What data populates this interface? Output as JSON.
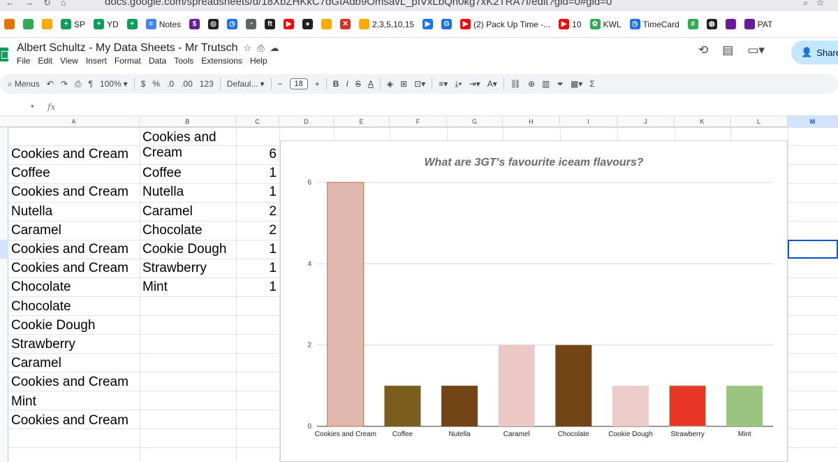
{
  "browser": {
    "url": "docs.google.com/spreadsheets/d/18XbZHKkC7dGIAdb9OmsavL_pIVxLbQn0kg7xK2TRA7I/edit?gid=0#gid=0"
  },
  "bookmarks": [
    {
      "label": "",
      "icon": "bookmark-orange-icon",
      "color": "#e37400"
    },
    {
      "label": "",
      "icon": "drive-icon",
      "color": "#34a853"
    },
    {
      "label": "",
      "icon": "folder-yellow-icon",
      "color": "#f9ab00"
    },
    {
      "label": "SP",
      "icon": "sheets-icon",
      "color": "#0f9d58"
    },
    {
      "label": "YD",
      "icon": "sheets-icon",
      "color": "#0f9d58"
    },
    {
      "label": "",
      "icon": "sheets-icon",
      "color": "#0f9d58"
    },
    {
      "label": "Notes",
      "icon": "docs-icon",
      "color": "#4285f4"
    },
    {
      "label": "",
      "icon": "dollar-icon",
      "color": "#6a1b9a"
    },
    {
      "label": "",
      "icon": "circle-icon",
      "color": "#202124"
    },
    {
      "label": "",
      "icon": "timer-icon",
      "color": "#1a73e8"
    },
    {
      "label": "",
      "icon": "arc-icon",
      "color": "#5f6368"
    },
    {
      "label": "",
      "icon": "ft-icon",
      "color": "#202124"
    },
    {
      "label": "",
      "icon": "youtube-icon",
      "color": "#ff0000"
    },
    {
      "label": "",
      "icon": "bomb-icon",
      "color": "#202124"
    },
    {
      "label": "",
      "icon": "folder-yellow-icon",
      "color": "#f9ab00"
    },
    {
      "label": "",
      "icon": "close-red-icon",
      "color": "#d93025"
    },
    {
      "label": "2,3,5,10,15",
      "icon": "folder-yellow-icon",
      "color": "#f9ab00"
    },
    {
      "label": "",
      "icon": "play-icon",
      "color": "#1a73e8"
    },
    {
      "label": "",
      "icon": "g-icon",
      "color": "#1a73e8"
    },
    {
      "label": "(2) Pack Up Time -...",
      "icon": "youtube-icon",
      "color": "#ff0000"
    },
    {
      "label": "10",
      "icon": "youtube-icon",
      "color": "#ff0000"
    },
    {
      "label": "KWL",
      "icon": "kwl-icon",
      "color": "#34a853"
    },
    {
      "label": "TimeCard",
      "icon": "timer-icon",
      "color": "#1a73e8"
    },
    {
      "label": "",
      "icon": "grid-icon",
      "color": "#34a853"
    },
    {
      "label": "",
      "icon": "abc-icon",
      "color": "#202124"
    },
    {
      "label": "",
      "icon": "bookmark-purple-icon",
      "color": "#6a1b9a"
    },
    {
      "label": "PAT",
      "icon": "bookmark-purple-icon",
      "color": "#6a1b9a"
    }
  ],
  "doc": {
    "title": "Albert Schultz - My Data Sheets - Mr Trutsch",
    "menu": [
      "File",
      "Edit",
      "View",
      "Insert",
      "Format",
      "Data",
      "Tools",
      "Extensions",
      "Help"
    ],
    "share_label": "Share"
  },
  "toolbar": {
    "menus_label": "Menus",
    "zoom": "100%",
    "currency": "$",
    "percent": "%",
    "dec_less": ".0",
    "dec_more": ".00",
    "number_format": "123",
    "font": "Defaul...",
    "font_size": "18",
    "bold": "B",
    "italic": "I",
    "strike": "S",
    "text_color": "A",
    "sum": "Σ"
  },
  "formula_bar": {
    "fx": "fx"
  },
  "columns": [
    "A",
    "B",
    "C",
    "D",
    "E",
    "F",
    "G",
    "H",
    "I",
    "J",
    "K",
    "L",
    "M"
  ],
  "selected_column": "M",
  "colA": [
    "Cookies and Cream",
    "Coffee",
    "Cookies and Cream",
    "Nutella",
    "Caramel",
    "Cookies and Cream",
    "Cookies and Cream",
    "Chocolate",
    "Chocolate",
    "Cookie Dough",
    "Strawberry",
    "Caramel",
    "Cookies and Cream",
    "Mint",
    "Cookies and Cream"
  ],
  "colB": [
    "Cookies and Cream",
    "Coffee",
    "Nutella",
    "Caramel",
    "Chocolate",
    "Cookie Dough",
    "Strawberry",
    "Mint"
  ],
  "colC": [
    "6",
    "1",
    "1",
    "2",
    "2",
    "1",
    "1",
    "1"
  ],
  "chart_data": {
    "type": "bar",
    "title": "What are 3GT's favourite iceam flavours?",
    "categories": [
      "Cookies and Cream",
      "Coffee",
      "Nutella",
      "Caramel",
      "Chocolate",
      "Cookie Dough",
      "Strawberry",
      "Mint"
    ],
    "values": [
      6,
      1,
      1,
      2,
      2,
      1,
      1,
      1
    ],
    "colors": [
      "#e0b8ae",
      "#7b5e1e",
      "#734416",
      "#ecc9c5",
      "#734416",
      "#ecccc9",
      "#e83526",
      "#9bc480"
    ],
    "ylim": [
      0,
      6
    ],
    "yticks": [
      "0",
      "2",
      "4",
      "6"
    ],
    "grid": true,
    "xlabel": "",
    "ylabel": ""
  }
}
